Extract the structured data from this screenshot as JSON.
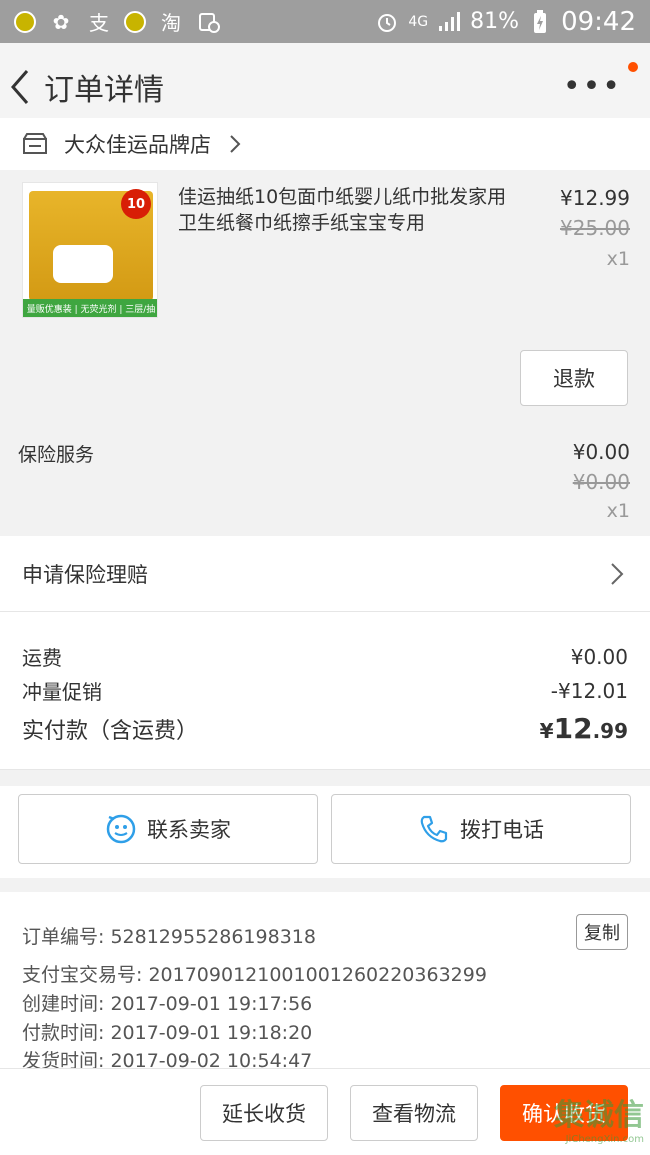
{
  "status_bar": {
    "left_icons": [
      "coin-icon",
      "flower-icon",
      "alipay-icon",
      "coin-icon",
      "taobao-icon",
      "calendar-clock-icon"
    ],
    "alipay_glyph": "支",
    "taobao_glyph": "淘",
    "network": "4G",
    "battery": "81%",
    "time": "09:42"
  },
  "header": {
    "title": "订单详情",
    "more": "•••"
  },
  "shop": {
    "name": "大众佳运品牌店"
  },
  "product": {
    "title": "佳运抽纸10包面巾纸婴儿纸巾批发家用卫生纸餐巾纸擦手纸宝宝专用",
    "price": "¥12.99",
    "original_price": "¥25.00",
    "quantity": "x1",
    "image_badge": "10",
    "image_strip": "量贩优惠装 | 无荧光剂 | 三层/抽",
    "refund_label": "退款"
  },
  "insurance": {
    "label": "保险服务",
    "price": "¥0.00",
    "original_price": "¥0.00",
    "quantity": "x1"
  },
  "claim": {
    "label": "申请保险理赔"
  },
  "fees": {
    "shipping_label": "运费",
    "shipping_value": "¥0.00",
    "promo_label": "冲量促销",
    "promo_value": "-¥12.01",
    "total_label": "实付款（含运费）",
    "total_currency": "¥",
    "total_int": "12",
    "total_dec": ".99"
  },
  "contact": {
    "seller_label": "联系卖家",
    "call_label": "拨打电话"
  },
  "order_info": {
    "order_no_label": "订单编号:",
    "order_no": "52812955286198318",
    "copy_label": "复制",
    "alipay_no_label": "支付宝交易号:",
    "alipay_no": "2017090121001001260220363299",
    "created_label": "创建时间:",
    "created": "2017-09-01 19:17:56",
    "paid_label": "付款时间:",
    "paid": "2017-09-01 19:18:20",
    "shipped_label": "发货时间:",
    "shipped": "2017-09-02 10:54:47"
  },
  "bottom_bar": {
    "extend_label": "延长收货",
    "logistics_label": "查看物流",
    "confirm_label": "确认收货"
  },
  "watermark": {
    "logo": "集诚信",
    "url": "JiChengXin.com"
  },
  "colors": {
    "accent": "#ff5000",
    "status_bar": "#9e9e9e",
    "link_blue": "#2f9fe8"
  }
}
